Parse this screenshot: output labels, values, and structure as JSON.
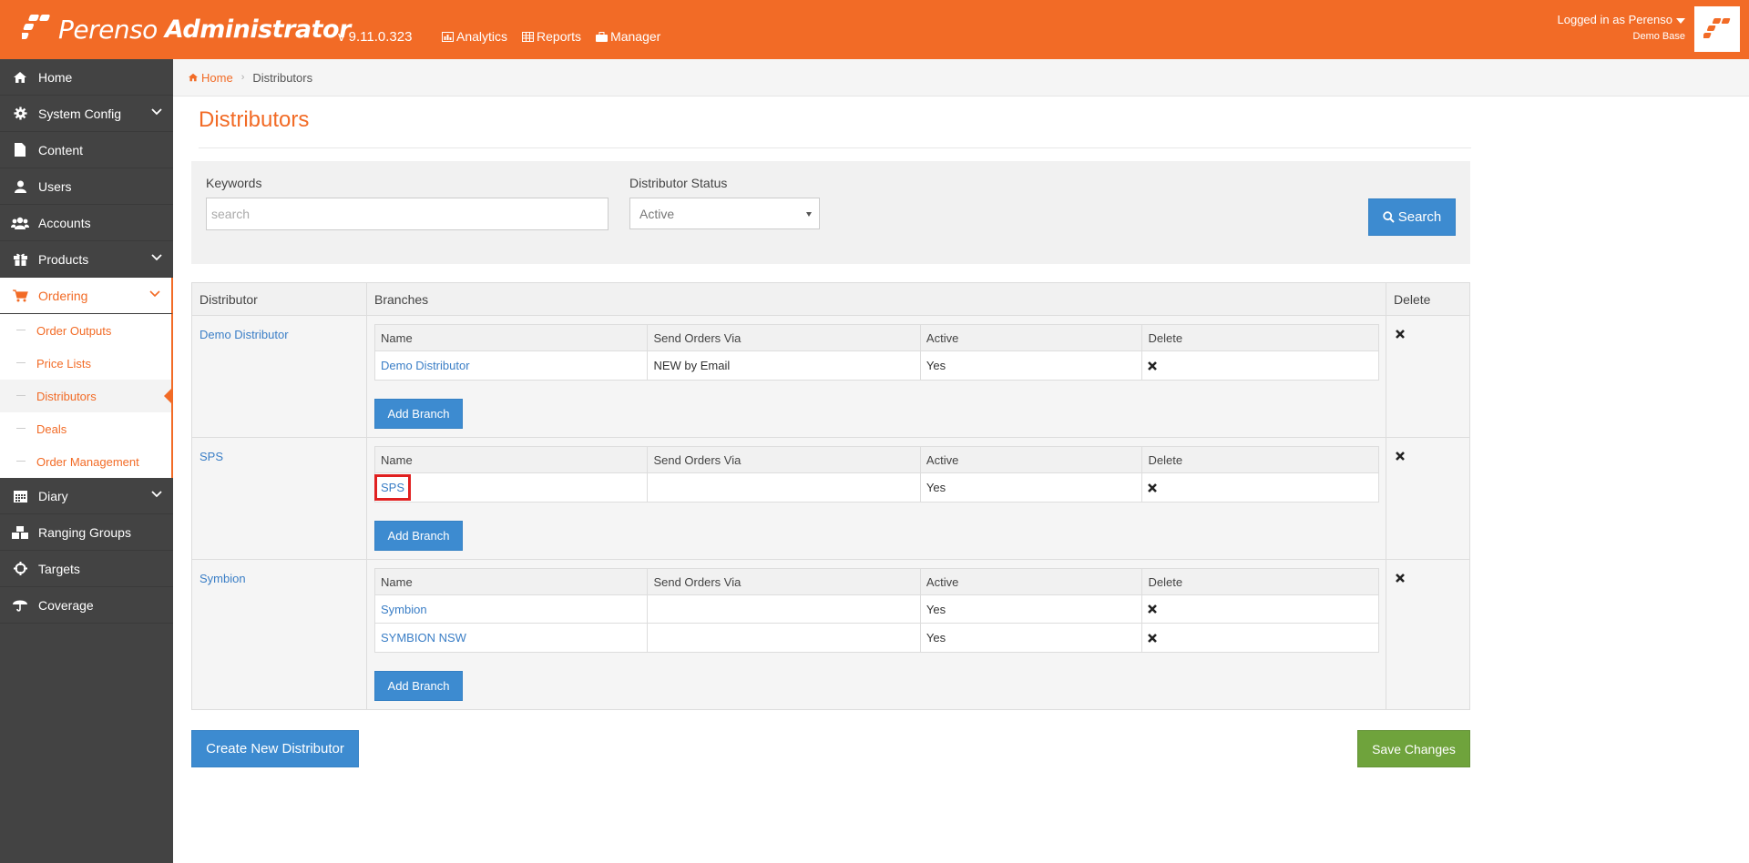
{
  "header": {
    "brand_name": "Perenso",
    "brand_suffix": "Administrator",
    "version": "v 9.11.0.323",
    "nav": [
      {
        "label": "Analytics",
        "icon": "chart-icon"
      },
      {
        "label": "Reports",
        "icon": "table-icon"
      },
      {
        "label": "Manager",
        "icon": "briefcase-icon"
      }
    ],
    "user": {
      "logged_in_label": "Logged in as Perenso",
      "tenant": "Demo Base"
    }
  },
  "sidebar": {
    "items": [
      {
        "label": "Home",
        "icon": "home-icon"
      },
      {
        "label": "System Config",
        "icon": "gear-icon"
      },
      {
        "label": "Content",
        "icon": "file-icon"
      },
      {
        "label": "Users",
        "icon": "user-icon"
      },
      {
        "label": "Accounts",
        "icon": "users-icon"
      },
      {
        "label": "Products",
        "icon": "gift-icon"
      },
      {
        "label": "Ordering",
        "icon": "cart-icon"
      },
      {
        "label": "Diary",
        "icon": "calendar-icon"
      },
      {
        "label": "Ranging Groups",
        "icon": "cubes-icon"
      },
      {
        "label": "Targets",
        "icon": "crosshairs-icon"
      },
      {
        "label": "Coverage",
        "icon": "umbrella-icon"
      }
    ],
    "ordering_sub": [
      {
        "label": "Order Outputs"
      },
      {
        "label": "Price Lists"
      },
      {
        "label": "Distributors"
      },
      {
        "label": "Deals"
      },
      {
        "label": "Order Management"
      }
    ]
  },
  "breadcrumb": {
    "home": "Home",
    "current": "Distributors"
  },
  "page": {
    "title": "Distributors"
  },
  "search": {
    "keywords_label": "Keywords",
    "keywords_placeholder": "search",
    "keywords_value": "",
    "status_label": "Distributor Status",
    "status_value": "Active",
    "search_button": "Search"
  },
  "table": {
    "headers": {
      "distributor": "Distributor",
      "branches": "Branches",
      "delete": "Delete"
    },
    "branch_headers": {
      "name": "Name",
      "send_via": "Send Orders Via",
      "active": "Active",
      "delete": "Delete"
    },
    "add_branch_label": "Add Branch",
    "distributors": [
      {
        "name": "Demo Distributor",
        "branches": [
          {
            "name": "Demo Distributor",
            "send_via": "NEW by Email",
            "active": "Yes"
          }
        ]
      },
      {
        "name": "SPS",
        "branches": [
          {
            "name": "SPS",
            "send_via": "",
            "active": "Yes"
          }
        ]
      },
      {
        "name": "Symbion",
        "branches": [
          {
            "name": "Symbion",
            "send_via": "",
            "active": "Yes"
          },
          {
            "name": "SYMBION NSW",
            "send_via": "",
            "active": "Yes"
          }
        ]
      }
    ]
  },
  "footer": {
    "create_button": "Create New Distributor",
    "save_button": "Save Changes"
  },
  "colors": {
    "accent": "#f26b26",
    "primary": "#3d8bd0",
    "success": "#6fa33c",
    "sidebar": "#434343",
    "highlight": "#e02020"
  }
}
